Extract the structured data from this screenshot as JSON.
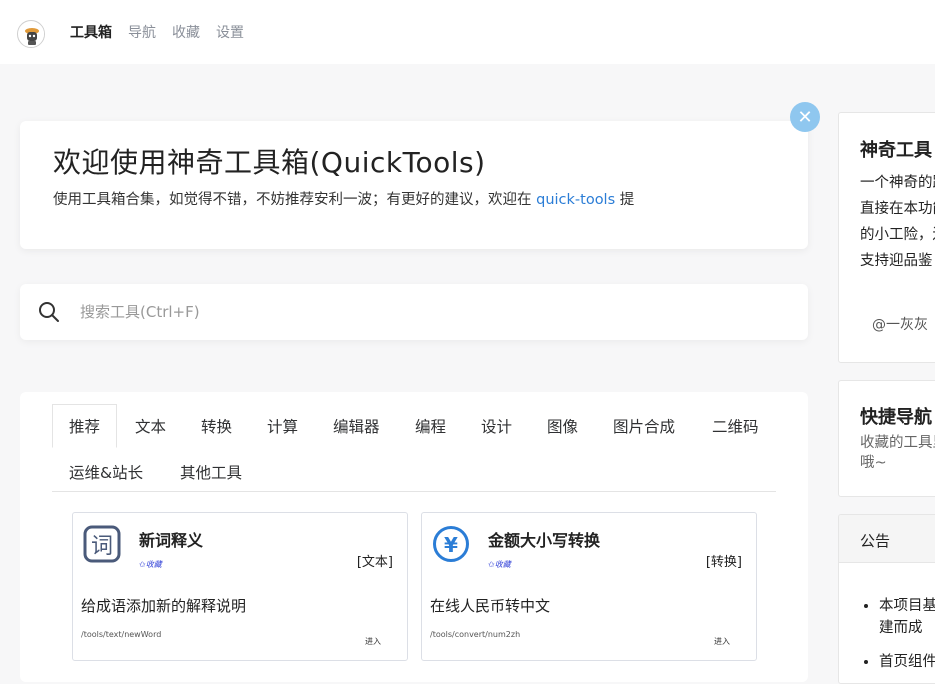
{
  "header": {
    "nav": [
      "工具箱",
      "导航",
      "收藏",
      "设置"
    ]
  },
  "welcome": {
    "title": "欢迎使用神奇工具箱(QuickTools)",
    "text_before": "使用工具箱合集，如觉得不错，不妨推荐安利一波；有更好的建议，欢迎在 ",
    "link": "quick-tools",
    "text_after": " 提",
    "close": "✕"
  },
  "search": {
    "placeholder": "搜索工具(Ctrl+F)"
  },
  "tabs": [
    "推荐",
    "文本",
    "转换",
    "计算",
    "编辑器",
    "编程",
    "设计",
    "图像",
    "图片合成",
    "二维码",
    "运维&站长",
    "其他工具"
  ],
  "cards": [
    {
      "title": "新词释义",
      "fav": "✩收藏",
      "category": "[文本]",
      "desc": "给成语添加新的解释说明",
      "path": "/tools/text/newWord",
      "enter": "进入",
      "icon": "ci-glyph-icon",
      "icon_glyph": "词"
    },
    {
      "title": "金额大小写转换",
      "fav": "✩收藏",
      "category": "[转换]",
      "desc": "在线人民币转中文",
      "path": "/tools/convert/num2zh",
      "enter": "进入",
      "icon": "yuan-icon",
      "icon_glyph": "¥"
    }
  ],
  "sidebar": {
    "intro": {
      "title": "神奇工具",
      "desc": "一个神奇的路直接在本功能的小工险，还支持迎品鉴",
      "author": "@一灰灰"
    },
    "quicknav": {
      "title": "快捷导航",
      "desc": "收藏的工具里哦~"
    },
    "notice": {
      "title": "公告",
      "items": [
        "本项目基构建而成",
        "首页组件"
      ]
    }
  },
  "colors": {
    "link": "#2b7dd6",
    "close_button": "#8fc7ef",
    "yuan_icon": "#2b7dd6"
  }
}
